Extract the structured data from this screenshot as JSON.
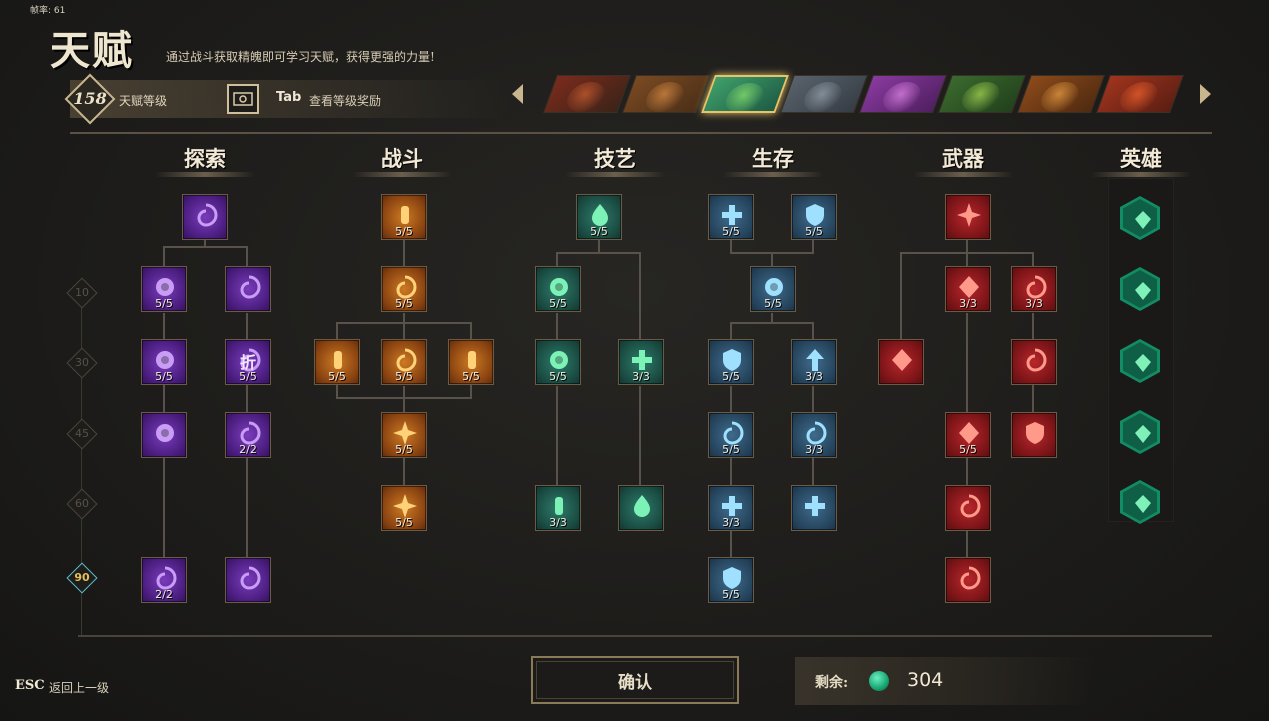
{
  "fps": "帧率: 61",
  "header": {
    "title": "天赋",
    "subtitle": "通过战斗获取精魄即可学习天赋，获得更强的力量!"
  },
  "level": {
    "number": "158",
    "label": "天赋等级",
    "tab_key": "Tab",
    "tab_text": "查看等级奖励"
  },
  "heroes": [
    {
      "name": "hero-1",
      "colors": [
        "#7a2b1c",
        "#3b2318"
      ],
      "face": "#b8572e"
    },
    {
      "name": "hero-2",
      "colors": [
        "#7a4a22",
        "#4b2f17"
      ],
      "face": "#c8813e"
    },
    {
      "name": "hero-3",
      "colors": [
        "#3fa06a",
        "#1e5a44"
      ],
      "face": "#7fd46a",
      "selected": true
    },
    {
      "name": "hero-4",
      "colors": [
        "#59626c",
        "#353c44"
      ],
      "face": "#8c97a3"
    },
    {
      "name": "hero-5",
      "colors": [
        "#8a3aa0",
        "#4e1f5f"
      ],
      "face": "#d07ad8"
    },
    {
      "name": "hero-6",
      "colors": [
        "#3a6a2e",
        "#22401c"
      ],
      "face": "#98c64b"
    },
    {
      "name": "hero-7",
      "colors": [
        "#8c4a1a",
        "#4f2a10"
      ],
      "face": "#d8913e"
    },
    {
      "name": "hero-8",
      "colors": [
        "#a0341e",
        "#5a1e12"
      ],
      "face": "#e05a2a"
    }
  ],
  "columns": [
    "探索",
    "战斗",
    "技艺",
    "生存",
    "武器",
    "英雄"
  ],
  "tiers": [
    {
      "label": "10"
    },
    {
      "label": "30"
    },
    {
      "label": "45"
    },
    {
      "label": "60"
    },
    {
      "label": "90",
      "active": true
    }
  ],
  "nodes": {
    "explore": [
      {
        "color": "purple",
        "icon": "vortex-icon",
        "count": ""
      },
      {
        "color": "purple",
        "icon": "coin-icon",
        "count": "5/5"
      },
      {
        "color": "purple",
        "icon": "pouch-icon",
        "count": ""
      },
      {
        "color": "purple",
        "icon": "coins-icon",
        "count": "5/5"
      },
      {
        "color": "purple",
        "icon": "discount-icon",
        "count": "5/5",
        "text": "折"
      },
      {
        "color": "purple",
        "icon": "coin-glow-icon",
        "count": ""
      },
      {
        "color": "purple",
        "icon": "crystal-icon",
        "count": "2/2"
      },
      {
        "color": "purple",
        "icon": "cycle-icon",
        "count": "2/2"
      },
      {
        "color": "purple",
        "icon": "swirl-icon",
        "count": ""
      }
    ],
    "combat": [
      {
        "color": "orange",
        "icon": "sword-icon",
        "count": "5/5"
      },
      {
        "color": "orange",
        "icon": "chest-icon",
        "count": "5/5"
      },
      {
        "color": "orange",
        "icon": "bullet-icon",
        "count": "5/5"
      },
      {
        "color": "orange",
        "icon": "missile-icon",
        "count": "5/5"
      },
      {
        "color": "orange",
        "icon": "bullet-alt-icon",
        "count": "5/5"
      },
      {
        "color": "orange",
        "icon": "crown-burst-icon",
        "count": "5/5"
      },
      {
        "color": "orange",
        "icon": "star-burst-icon",
        "count": "5/5"
      }
    ],
    "craft": [
      {
        "color": "teal",
        "icon": "flame-icon",
        "count": "5/5"
      },
      {
        "color": "teal",
        "icon": "bomb-icon",
        "count": "5/5"
      },
      {
        "color": "teal",
        "icon": "timer-icon",
        "count": "5/5"
      },
      {
        "color": "teal",
        "icon": "heal-cycle-icon",
        "count": "3/3"
      },
      {
        "color": "teal",
        "icon": "battery-icon",
        "count": "3/3"
      },
      {
        "color": "teal",
        "icon": "leaf-wings-icon",
        "count": ""
      }
    ],
    "survive": [
      {
        "color": "blue",
        "icon": "plus-heal-icon",
        "count": "5/5"
      },
      {
        "color": "blue",
        "icon": "wing-shield-icon",
        "count": "5/5"
      },
      {
        "color": "blue",
        "icon": "orb-icon",
        "count": "5/5"
      },
      {
        "color": "blue",
        "icon": "shield-icon",
        "count": "5/5"
      },
      {
        "color": "blue",
        "icon": "up-arrow-icon",
        "count": "3/3"
      },
      {
        "color": "blue",
        "icon": "fan-icon",
        "count": "5/5"
      },
      {
        "color": "blue",
        "icon": "spiral-icon",
        "count": "3/3"
      },
      {
        "color": "blue",
        "icon": "plus-circle-icon",
        "count": "3/3"
      },
      {
        "color": "blue",
        "icon": "beam-heal-icon",
        "count": ""
      },
      {
        "color": "blue",
        "icon": "armor-icon",
        "count": "5/5"
      }
    ],
    "weapon": [
      {
        "color": "red",
        "icon": "crosshair-icon",
        "count": ""
      },
      {
        "color": "red",
        "icon": "diamond-link-icon",
        "count": "3/3"
      },
      {
        "color": "red",
        "icon": "fist-icon",
        "count": "3/3"
      },
      {
        "color": "red",
        "icon": "diamond-icon",
        "count": ""
      },
      {
        "color": "red",
        "icon": "cloud-icon",
        "count": ""
      },
      {
        "color": "red",
        "icon": "diamond-stack-icon",
        "count": "5/5"
      },
      {
        "color": "red",
        "icon": "shield-up-icon",
        "count": ""
      },
      {
        "color": "red",
        "icon": "anvil-icon",
        "count": ""
      },
      {
        "color": "red",
        "icon": "cannon-icon",
        "count": ""
      }
    ],
    "hero": [
      {
        "icon": "bird-icon"
      },
      {
        "icon": "heart-wings-icon"
      },
      {
        "icon": "hex-gem-icon"
      },
      {
        "icon": "claw-icon"
      },
      {
        "icon": "leaf-icon"
      }
    ]
  },
  "footer": {
    "esc_key": "ESC",
    "esc_text": "返回上一级",
    "confirm": "确认",
    "remain_label": "剩余:",
    "remain_value": "304"
  }
}
